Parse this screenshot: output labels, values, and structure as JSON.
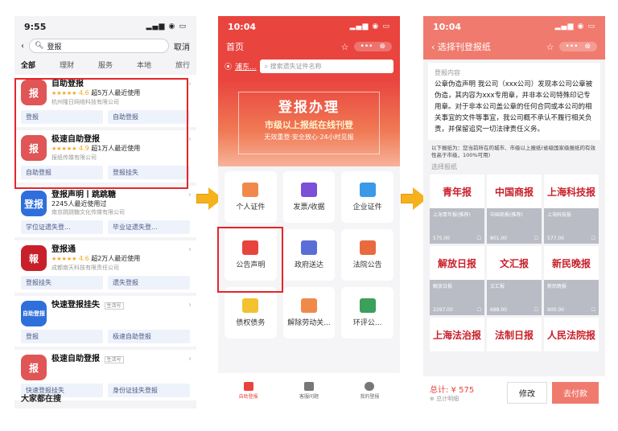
{
  "phone1": {
    "time": "9:55",
    "search_value": "登报",
    "cancel": "取消",
    "categories": [
      "全部",
      "理财",
      "服务",
      "本地",
      "旅行"
    ],
    "apps": [
      {
        "name": "自助登报",
        "rating": "4.6",
        "users": "超5万人最近使用",
        "company": "杭州隆日网络科技有限公司",
        "tags": [
          "登报",
          "自助登报"
        ],
        "logo_color": "#e05555",
        "logo_text": "报"
      },
      {
        "name": "极速自助登报",
        "rating": "4.9",
        "users": "超1万人最近使用",
        "company": "报纸传媒有限公司",
        "tags": [
          "自助登报",
          "登报挂失"
        ],
        "logo_color": "#e05555",
        "logo_text": "报"
      },
      {
        "name": "登报声明丨跳跳糖",
        "rating": "",
        "users": "2245人最近使用过",
        "company": "南京跳跳糖文化传媒有限公司",
        "tags": [
          "学位证遗失登...",
          "毕业证遗失登..."
        ],
        "logo_color": "#2f6fdc",
        "logo_text": "登报"
      },
      {
        "name": "登报通",
        "rating": "4.6",
        "users": "超2万人最近使用",
        "company": "成都南天科技有限责任公司",
        "tags": [
          "登报挂失",
          "遗失登报"
        ],
        "logo_color": "#c8202a",
        "logo_text": "報"
      },
      {
        "name": "快速登报挂失",
        "rating": "",
        "users": "",
        "company": "",
        "badge": "生活号",
        "tags": [
          "登报",
          "极速自助登报"
        ],
        "logo_color": "#2f6fdc",
        "logo_text": "自助登报"
      },
      {
        "name": "极速自助登报",
        "rating": "",
        "users": "",
        "company": "",
        "badge": "生活号",
        "tags": [
          "快速登报挂失",
          "身份证挂失登报"
        ],
        "logo_color": "#e05555",
        "logo_text": "报"
      }
    ],
    "footer": "大家都在搜"
  },
  "phone2": {
    "time": "10:04",
    "nav_title": "首页",
    "location": "浦东...",
    "search_placeholder": "搜索遗失证件名称",
    "banner_title": "登报办理",
    "banner_sub": "市级以上报纸在线刊登",
    "banner_sub2": "无效重登·安全放心·24小时见报",
    "tiles": [
      {
        "label": "个人证件",
        "color": "#f08a4b"
      },
      {
        "label": "发票/收据",
        "color": "#7b4fd6"
      },
      {
        "label": "企业证件",
        "color": "#3a9ae8"
      },
      {
        "label": "公告声明",
        "color": "#e8443e"
      },
      {
        "label": "政府送达",
        "color": "#5b6ed6"
      },
      {
        "label": "法院公告",
        "color": "#e86a3e"
      },
      {
        "label": "债权债务",
        "color": "#f2c230"
      },
      {
        "label": "解除劳动关...",
        "color": "#f08a4b"
      },
      {
        "label": "环评公...",
        "color": "#3aa05a"
      }
    ],
    "tabs": [
      "自助登报",
      "客服问题",
      "我的登报"
    ]
  },
  "phone3": {
    "time": "10:04",
    "nav_title": "选择刊登报纸",
    "content_label": "登报内容",
    "content": "公章伪造声明 我公司（xxx公司）发现本公司公章被伪造，其内容为xxx专用章，并非本公司特殊印记专用章。对于非本公司盖公章的任何合同或本公司的相关事宜的文件等事宜，我公司概不承认不履行相关负责，并保留追究一切法律责任义务。",
    "note": "以下报纸为：您当前所在的城市、市级以上报纸(省级国家级报纸的有效性高于市级，100%可用)",
    "choose_label": "选择报纸",
    "papers": [
      {
        "mast": "青年报",
        "name": "上海青年报(推荐)",
        "price": "575.00",
        "color": "#c8202a"
      },
      {
        "mast": "中国商报",
        "name": "中国商报(推荐)",
        "price": "801.00",
        "color": "#c8202a"
      },
      {
        "mast": "上海科技报",
        "name": "上海科技报",
        "price": "577.00",
        "color": "#c8202a"
      },
      {
        "mast": "解放日报",
        "name": "解放日报",
        "price": "2297.00",
        "color": "#c8202a"
      },
      {
        "mast": "文汇报",
        "name": "文汇报",
        "price": "688.00",
        "color": "#c8202a"
      },
      {
        "mast": "新民晚报",
        "name": "新民晚报",
        "price": "900.00",
        "color": "#c8202a"
      },
      {
        "mast": "上海法治报",
        "name": "",
        "price": "",
        "color": "#c8202a"
      },
      {
        "mast": "法制日报",
        "name": "",
        "price": "",
        "color": "#c8202a"
      },
      {
        "mast": "人民法院报",
        "name": "",
        "price": "",
        "color": "#c8202a"
      }
    ],
    "total": "总计: ¥ 575",
    "detail": "总计明细",
    "edit": "修改",
    "pay": "去付款"
  }
}
